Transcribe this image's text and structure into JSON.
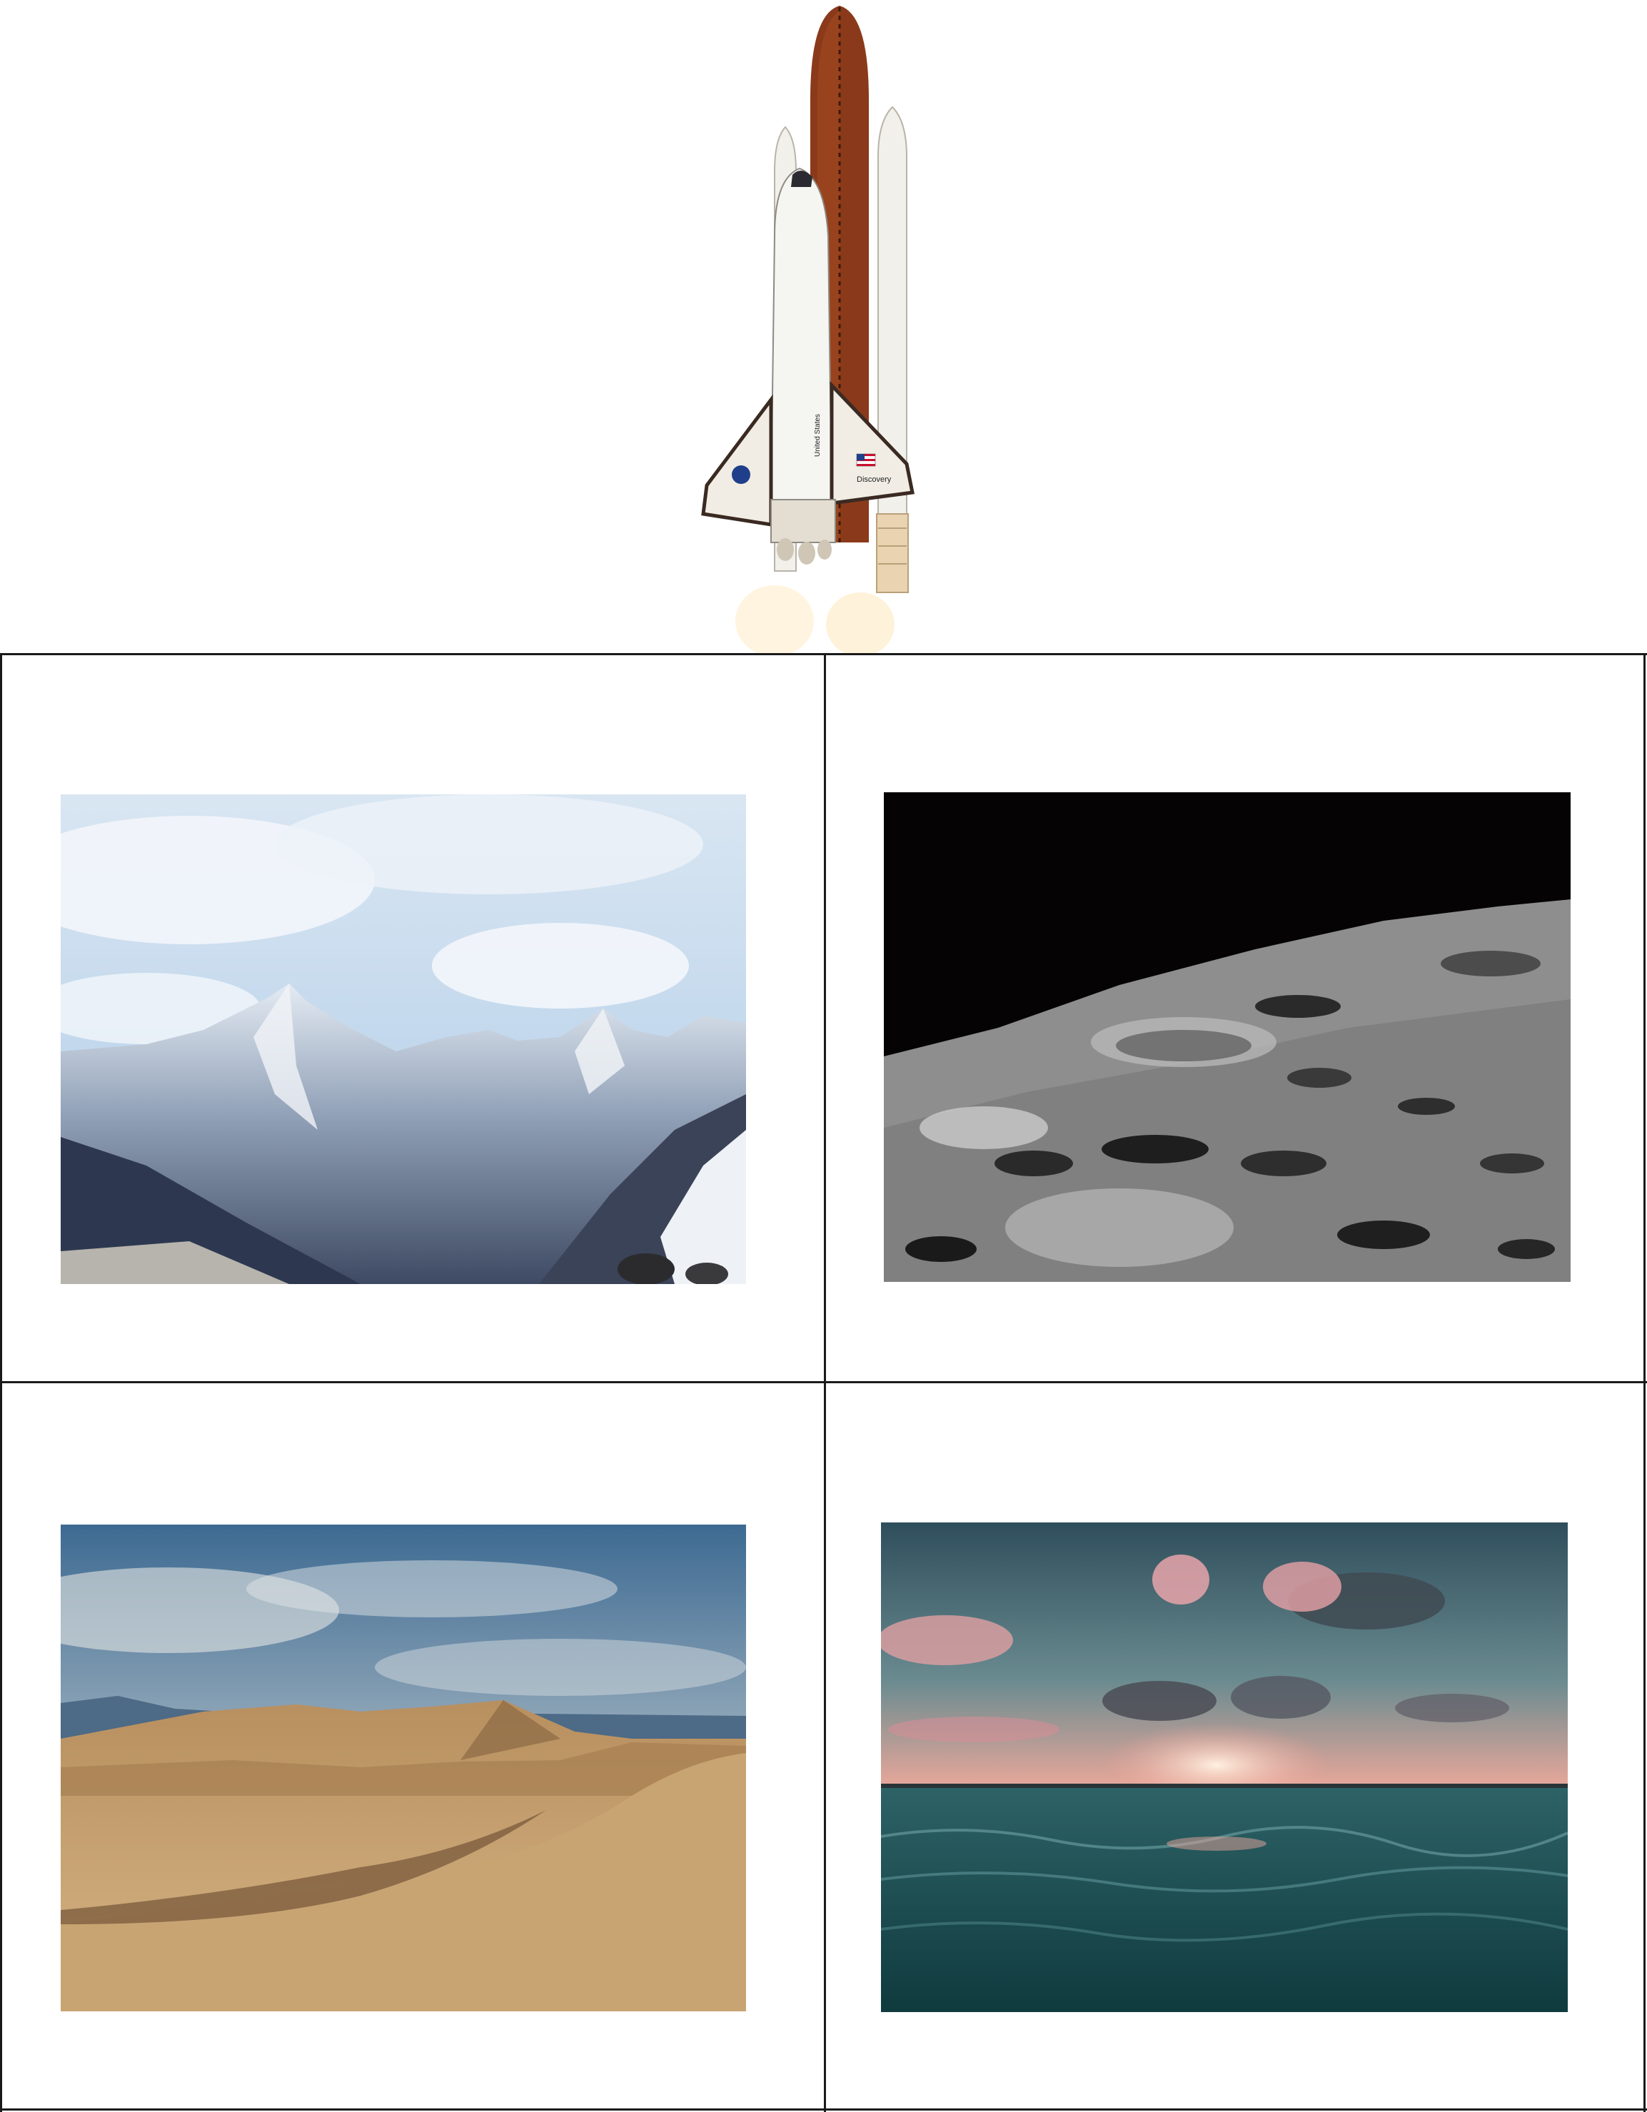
{
  "page": {
    "background": "#ffffff",
    "grid_line_color": "#1a1a1a"
  },
  "shuttle": {
    "icon": "space-shuttle-icon",
    "orbiter_name": "Discovery",
    "wing_text": "United States",
    "flag": "us-flag-icon",
    "colors": {
      "tank": "#8a3a1a",
      "booster": "#f2f0ea",
      "orbiter": "#f5f5f2",
      "wing_edge": "#3a2a22"
    }
  },
  "grid": {
    "cells": [
      {
        "id": "mountain",
        "icon": "snowy-mountain-photo",
        "colors": {
          "sky": "#c9dff2",
          "rock": "#6d7c93",
          "snow": "#eef2f6"
        }
      },
      {
        "id": "moon",
        "icon": "lunar-surface-photo",
        "colors": {
          "space": "#050303",
          "surface": "#8e8e8e",
          "crater": "#2a2a2a"
        }
      },
      {
        "id": "desert",
        "icon": "sand-dunes-photo",
        "colors": {
          "sky": "#4f7fa8",
          "sand": "#c9a473",
          "shadow": "#7a5a3c"
        }
      },
      {
        "id": "ocean",
        "icon": "ocean-sunset-photo",
        "colors": {
          "sky": "#3a5c66",
          "cloud": "#e8a0a6",
          "water": "#1f4f55"
        }
      }
    ]
  }
}
